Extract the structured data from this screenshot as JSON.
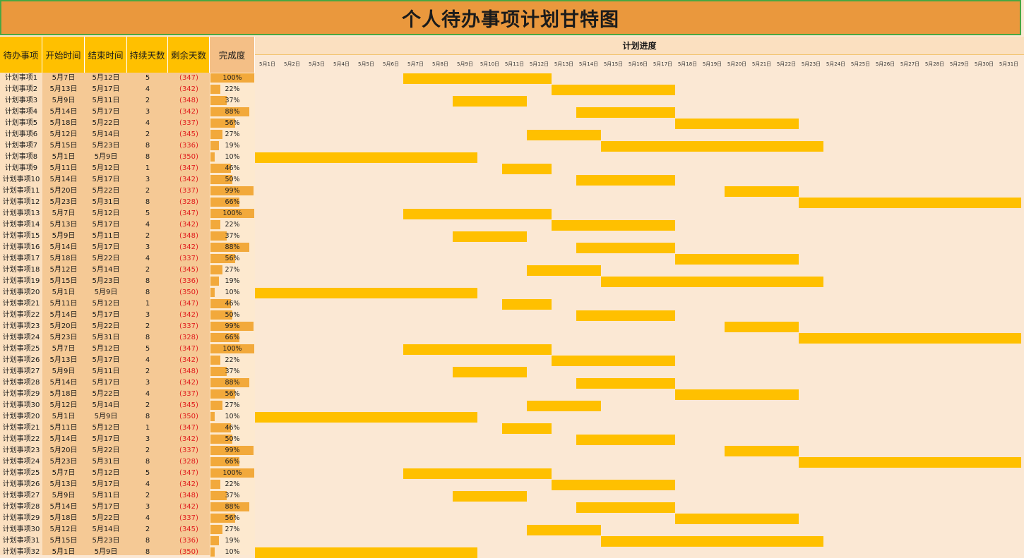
{
  "title": "个人待办事项计划甘特图",
  "headers": {
    "name": "待办事项",
    "start": "开始时间",
    "end": "结束时间",
    "duration": "持续天数",
    "remaining": "剩余天数",
    "progress": "完成度",
    "plan": "计划进度"
  },
  "days": [
    "5月1日",
    "5月2日",
    "5月3日",
    "5月4日",
    "5月5日",
    "5月6日",
    "5月7日",
    "5月8日",
    "5月9日",
    "5月10日",
    "5月11日",
    "5月12日",
    "5月13日",
    "5月14日",
    "5月15日",
    "5月16日",
    "5月17日",
    "5月18日",
    "5月19日",
    "5月20日",
    "5月21日",
    "5月22日",
    "5月23日",
    "5月24日",
    "5月25日",
    "5月26日",
    "5月27日",
    "5月28日",
    "5月29日",
    "5月30日",
    "5月31日"
  ],
  "colors": {
    "bar": "#ffc000",
    "progress": "#f2a93b",
    "remaining": "#e02020",
    "title_bg": "#ea983d"
  },
  "rows": [
    {
      "name": "计划事项1",
      "start": "5月7日",
      "end": "5月12日",
      "dur": "5",
      "rem": "(347)",
      "pct": "100%",
      "s": 7,
      "e": 12
    },
    {
      "name": "计划事项2",
      "start": "5月13日",
      "end": "5月17日",
      "dur": "4",
      "rem": "(342)",
      "pct": "22%",
      "s": 13,
      "e": 17
    },
    {
      "name": "计划事项3",
      "start": "5月9日",
      "end": "5月11日",
      "dur": "2",
      "rem": "(348)",
      "pct": "37%",
      "s": 9,
      "e": 11
    },
    {
      "name": "计划事项4",
      "start": "5月14日",
      "end": "5月17日",
      "dur": "3",
      "rem": "(342)",
      "pct": "88%",
      "s": 14,
      "e": 17
    },
    {
      "name": "计划事项5",
      "start": "5月18日",
      "end": "5月22日",
      "dur": "4",
      "rem": "(337)",
      "pct": "56%",
      "s": 18,
      "e": 22
    },
    {
      "name": "计划事项6",
      "start": "5月12日",
      "end": "5月14日",
      "dur": "2",
      "rem": "(345)",
      "pct": "27%",
      "s": 12,
      "e": 14
    },
    {
      "name": "计划事项7",
      "start": "5月15日",
      "end": "5月23日",
      "dur": "8",
      "rem": "(336)",
      "pct": "19%",
      "s": 15,
      "e": 23
    },
    {
      "name": "计划事项8",
      "start": "5月1日",
      "end": "5月9日",
      "dur": "8",
      "rem": "(350)",
      "pct": "10%",
      "s": 1,
      "e": 9
    },
    {
      "name": "计划事项9",
      "start": "5月11日",
      "end": "5月12日",
      "dur": "1",
      "rem": "(347)",
      "pct": "46%",
      "s": 11,
      "e": 12
    },
    {
      "name": "计划事项10",
      "start": "5月14日",
      "end": "5月17日",
      "dur": "3",
      "rem": "(342)",
      "pct": "50%",
      "s": 14,
      "e": 17
    },
    {
      "name": "计划事项11",
      "start": "5月20日",
      "end": "5月22日",
      "dur": "2",
      "rem": "(337)",
      "pct": "99%",
      "s": 20,
      "e": 22
    },
    {
      "name": "计划事项12",
      "start": "5月23日",
      "end": "5月31日",
      "dur": "8",
      "rem": "(328)",
      "pct": "66%",
      "s": 23,
      "e": 31
    },
    {
      "name": "计划事项13",
      "start": "5月7日",
      "end": "5月12日",
      "dur": "5",
      "rem": "(347)",
      "pct": "100%",
      "s": 7,
      "e": 12
    },
    {
      "name": "计划事项14",
      "start": "5月13日",
      "end": "5月17日",
      "dur": "4",
      "rem": "(342)",
      "pct": "22%",
      "s": 13,
      "e": 17
    },
    {
      "name": "计划事项15",
      "start": "5月9日",
      "end": "5月11日",
      "dur": "2",
      "rem": "(348)",
      "pct": "37%",
      "s": 9,
      "e": 11
    },
    {
      "name": "计划事项16",
      "start": "5月14日",
      "end": "5月17日",
      "dur": "3",
      "rem": "(342)",
      "pct": "88%",
      "s": 14,
      "e": 17
    },
    {
      "name": "计划事项17",
      "start": "5月18日",
      "end": "5月22日",
      "dur": "4",
      "rem": "(337)",
      "pct": "56%",
      "s": 18,
      "e": 22
    },
    {
      "name": "计划事项18",
      "start": "5月12日",
      "end": "5月14日",
      "dur": "2",
      "rem": "(345)",
      "pct": "27%",
      "s": 12,
      "e": 14
    },
    {
      "name": "计划事项19",
      "start": "5月15日",
      "end": "5月23日",
      "dur": "8",
      "rem": "(336)",
      "pct": "19%",
      "s": 15,
      "e": 23
    },
    {
      "name": "计划事项20",
      "start": "5月1日",
      "end": "5月9日",
      "dur": "8",
      "rem": "(350)",
      "pct": "10%",
      "s": 1,
      "e": 9
    },
    {
      "name": "计划事项21",
      "start": "5月11日",
      "end": "5月12日",
      "dur": "1",
      "rem": "(347)",
      "pct": "46%",
      "s": 11,
      "e": 12
    },
    {
      "name": "计划事项22",
      "start": "5月14日",
      "end": "5月17日",
      "dur": "3",
      "rem": "(342)",
      "pct": "50%",
      "s": 14,
      "e": 17
    },
    {
      "name": "计划事项23",
      "start": "5月20日",
      "end": "5月22日",
      "dur": "2",
      "rem": "(337)",
      "pct": "99%",
      "s": 20,
      "e": 22
    },
    {
      "name": "计划事项24",
      "start": "5月23日",
      "end": "5月31日",
      "dur": "8",
      "rem": "(328)",
      "pct": "66%",
      "s": 23,
      "e": 31
    },
    {
      "name": "计划事项25",
      "start": "5月7日",
      "end": "5月12日",
      "dur": "5",
      "rem": "(347)",
      "pct": "100%",
      "s": 7,
      "e": 12
    },
    {
      "name": "计划事项26",
      "start": "5月13日",
      "end": "5月17日",
      "dur": "4",
      "rem": "(342)",
      "pct": "22%",
      "s": 13,
      "e": 17
    },
    {
      "name": "计划事项27",
      "start": "5月9日",
      "end": "5月11日",
      "dur": "2",
      "rem": "(348)",
      "pct": "37%",
      "s": 9,
      "e": 11
    },
    {
      "name": "计划事项28",
      "start": "5月14日",
      "end": "5月17日",
      "dur": "3",
      "rem": "(342)",
      "pct": "88%",
      "s": 14,
      "e": 17
    },
    {
      "name": "计划事项29",
      "start": "5月18日",
      "end": "5月22日",
      "dur": "4",
      "rem": "(337)",
      "pct": "56%",
      "s": 18,
      "e": 22
    },
    {
      "name": "计划事项30",
      "start": "5月12日",
      "end": "5月14日",
      "dur": "2",
      "rem": "(345)",
      "pct": "27%",
      "s": 12,
      "e": 14
    },
    {
      "name": "计划事项20",
      "start": "5月1日",
      "end": "5月9日",
      "dur": "8",
      "rem": "(350)",
      "pct": "10%",
      "s": 1,
      "e": 9
    },
    {
      "name": "计划事项21",
      "start": "5月11日",
      "end": "5月12日",
      "dur": "1",
      "rem": "(347)",
      "pct": "46%",
      "s": 11,
      "e": 12
    },
    {
      "name": "计划事项22",
      "start": "5月14日",
      "end": "5月17日",
      "dur": "3",
      "rem": "(342)",
      "pct": "50%",
      "s": 14,
      "e": 17
    },
    {
      "name": "计划事项23",
      "start": "5月20日",
      "end": "5月22日",
      "dur": "2",
      "rem": "(337)",
      "pct": "99%",
      "s": 20,
      "e": 22
    },
    {
      "name": "计划事项24",
      "start": "5月23日",
      "end": "5月31日",
      "dur": "8",
      "rem": "(328)",
      "pct": "66%",
      "s": 23,
      "e": 31
    },
    {
      "name": "计划事项25",
      "start": "5月7日",
      "end": "5月12日",
      "dur": "5",
      "rem": "(347)",
      "pct": "100%",
      "s": 7,
      "e": 12
    },
    {
      "name": "计划事项26",
      "start": "5月13日",
      "end": "5月17日",
      "dur": "4",
      "rem": "(342)",
      "pct": "22%",
      "s": 13,
      "e": 17
    },
    {
      "name": "计划事项27",
      "start": "5月9日",
      "end": "5月11日",
      "dur": "2",
      "rem": "(348)",
      "pct": "37%",
      "s": 9,
      "e": 11
    },
    {
      "name": "计划事项28",
      "start": "5月14日",
      "end": "5月17日",
      "dur": "3",
      "rem": "(342)",
      "pct": "88%",
      "s": 14,
      "e": 17
    },
    {
      "name": "计划事项29",
      "start": "5月18日",
      "end": "5月22日",
      "dur": "4",
      "rem": "(337)",
      "pct": "56%",
      "s": 18,
      "e": 22
    },
    {
      "name": "计划事项30",
      "start": "5月12日",
      "end": "5月14日",
      "dur": "2",
      "rem": "(345)",
      "pct": "27%",
      "s": 12,
      "e": 14
    },
    {
      "name": "计划事项31",
      "start": "5月15日",
      "end": "5月23日",
      "dur": "8",
      "rem": "(336)",
      "pct": "19%",
      "s": 15,
      "e": 23
    },
    {
      "name": "计划事项32",
      "start": "5月1日",
      "end": "5月9日",
      "dur": "8",
      "rem": "(350)",
      "pct": "10%",
      "s": 1,
      "e": 9
    }
  ]
}
